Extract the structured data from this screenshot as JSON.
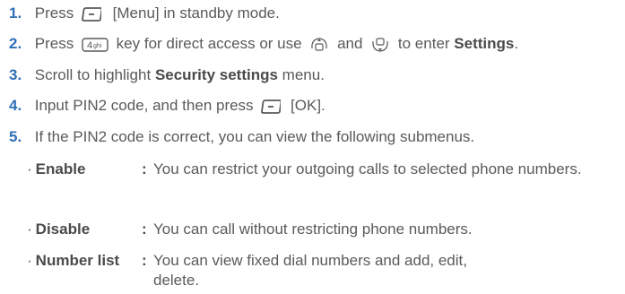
{
  "steps": [
    {
      "num": "1.",
      "text_before": "Press",
      "text_after": "[Menu] in standby mode."
    },
    {
      "num": "2.",
      "text_before": "Press",
      "text_mid": "key for direct access or use",
      "text_and": "and",
      "text_end": "to enter",
      "bold_end": "Settings",
      "period": "."
    },
    {
      "num": "3.",
      "text_before": "Scroll to highlight",
      "bold": "Security settings",
      "text_after": "menu."
    },
    {
      "num": "4.",
      "text_before": "Input PIN2 code, and then press",
      "text_after": "[OK]."
    },
    {
      "num": "5.",
      "text": "If the PIN2 code is correct, you can view the following submenus."
    }
  ],
  "submenus": [
    {
      "bullet": "·",
      "term": "Enable",
      "colon": ":",
      "desc": "You can restrict your outgoing calls to selected phone numbers."
    },
    {
      "bullet": "·",
      "term": "Disable",
      "colon": ":",
      "desc": "You can call without restricting phone numbers."
    },
    {
      "bullet": "·",
      "term": "Number list",
      "colon": ":",
      "desc": "You can view fixed dial numbers and add, edit, delete."
    }
  ],
  "icons": {
    "menu_key": "soft-key-icon",
    "num4_key": "number-4-key-icon",
    "nav_up": "navigation-up-icon",
    "nav_down": "navigation-down-icon",
    "ok_key": "soft-key-icon"
  }
}
